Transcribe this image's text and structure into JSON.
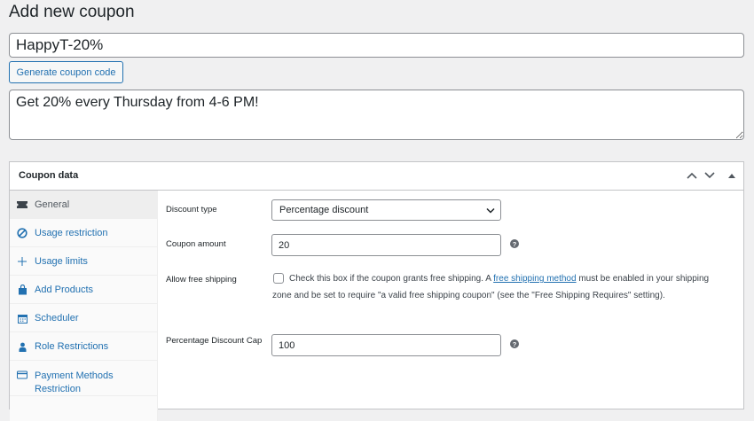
{
  "page": {
    "title": "Add new coupon",
    "coupon_code": "HappyT-20%",
    "generate_label": "Generate coupon code",
    "description": "Get 20% every Thursday from 4-6 PM!"
  },
  "panel": {
    "title": "Coupon data",
    "tabs": [
      {
        "label": "General",
        "icon": "ticket-icon"
      },
      {
        "label": "Usage restriction",
        "icon": "block-icon"
      },
      {
        "label": "Usage limits",
        "icon": "plus-icon"
      },
      {
        "label": "Add Products",
        "icon": "bag-icon"
      },
      {
        "label": "Scheduler",
        "icon": "calendar-icon"
      },
      {
        "label": "Role Restrictions",
        "icon": "user-icon"
      },
      {
        "label": "Payment Methods Restriction",
        "icon": "card-icon"
      }
    ]
  },
  "general": {
    "discount_type_label": "Discount type",
    "discount_type_value": "Percentage discount",
    "coupon_amount_label": "Coupon amount",
    "coupon_amount_value": "20",
    "free_shipping_label": "Allow free shipping",
    "free_shipping_text_before": "Check this box if the coupon grants free shipping. A ",
    "free_shipping_link": "free shipping method",
    "free_shipping_text_after": " must be enabled in your shipping zone and be set to require \"a valid free shipping coupon\" (see the \"Free Shipping Requires\" setting).",
    "cap_label": "Percentage Discount Cap",
    "cap_value": "100",
    "help_glyph": "?"
  },
  "colors": {
    "accent": "#2271b1",
    "border": "#c3c4c7",
    "background": "#f0f0f1"
  }
}
